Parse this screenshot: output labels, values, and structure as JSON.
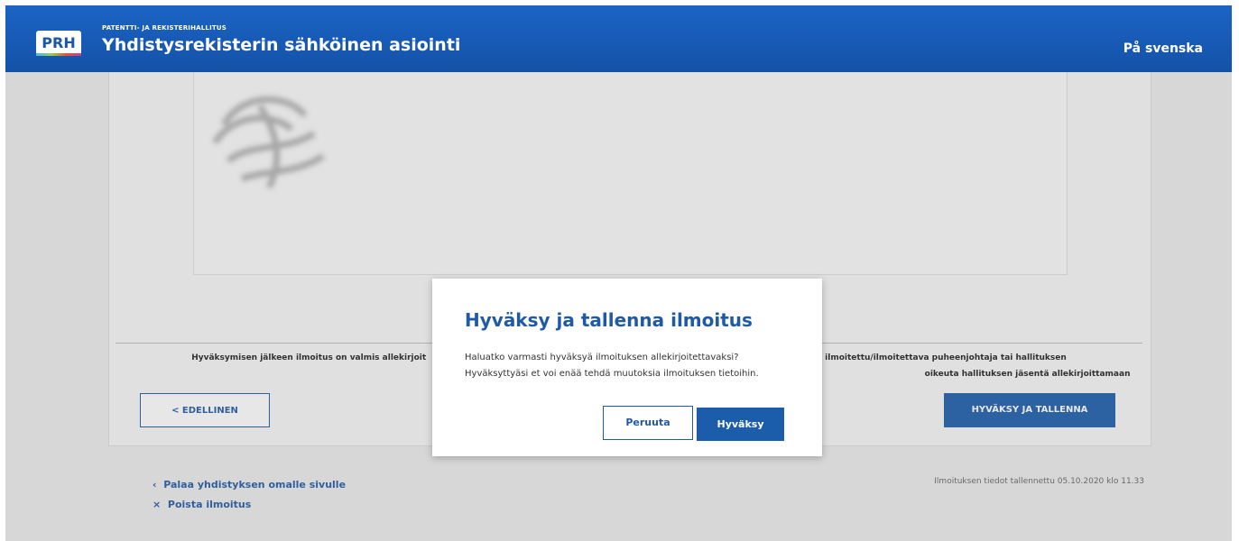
{
  "header": {
    "logo_text": "PRH",
    "org_name": "PATENTTI- JA REKISTERIHALLITUS",
    "app_title": "Yhdistysrekisterin sähköinen asiointi",
    "language_link": "På svenska"
  },
  "form": {
    "info_line1_left": "Hyväksymisen jälkeen ilmoitus on valmis allekirjoit",
    "info_line1_right": "lin ilmoitettu/ilmoitettava puheenjohtaja tai hallituksen",
    "info_line2_right": "oikeuta hallituksen jäsentä allekirjoittamaan ilmoitusta).",
    "previous_button": "< EDELLINEN",
    "approve_save_button": "HYVÄKSY JA TALLENNA"
  },
  "footer": {
    "back_link": "Palaa yhdistyksen omalle sivulle",
    "delete_link": "Poista ilmoitus",
    "saved_note": "Ilmoituksen tiedot tallennettu 05.10.2020 klo 11.33"
  },
  "modal": {
    "title": "Hyväksy ja tallenna ilmoitus",
    "text_line1": "Haluatko varmasti hyväksyä ilmoituksen allekirjoitettavaksi?",
    "text_line2": "Hyväksyttyäsi et voi enää tehdä muutoksia ilmoituksen tietoihin.",
    "cancel_button": "Peruuta",
    "confirm_button": "Hyväksy"
  },
  "colors": {
    "header_blue": "#1452a8",
    "button_blue": "#1b5cab",
    "link_blue": "#1f5aa8"
  }
}
